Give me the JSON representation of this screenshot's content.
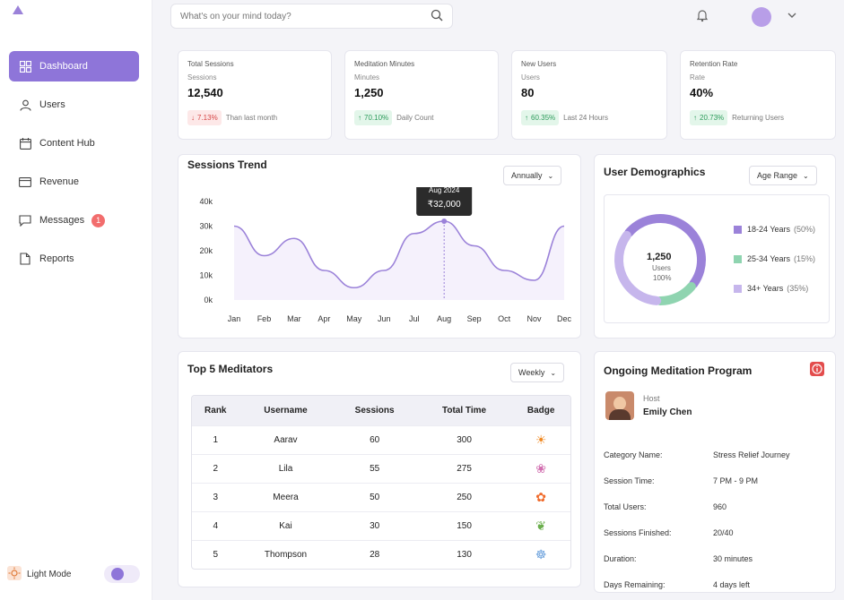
{
  "sidebar": {
    "items": [
      {
        "label": "Dashboard",
        "icon": "grid-icon",
        "active": true
      },
      {
        "label": "Users",
        "icon": "user-icon"
      },
      {
        "label": "Content Hub",
        "icon": "calendar-icon"
      },
      {
        "label": "Revenue",
        "icon": "card-icon"
      },
      {
        "label": "Messages",
        "icon": "message-icon",
        "badge": "1"
      },
      {
        "label": "Reports",
        "icon": "document-icon"
      }
    ],
    "footer": {
      "label": "Light Mode"
    }
  },
  "header": {
    "search_placeholder": "What's on your mind today?"
  },
  "stats": [
    {
      "title": "Total Sessions",
      "sub": "Sessions",
      "value": "12,540",
      "change": "7.13%",
      "dir": "down",
      "caption": "Than last month"
    },
    {
      "title": "Meditation Minutes",
      "sub": "Minutes",
      "value": "1,250",
      "change": "70.10%",
      "dir": "up",
      "caption": "Daily Count"
    },
    {
      "title": "New Users",
      "sub": "Users",
      "value": "80",
      "change": "60.35%",
      "dir": "up",
      "caption": "Last 24 Hours"
    },
    {
      "title": "Retention Rate",
      "sub": "Rate",
      "value": "40%",
      "change": "20.73%",
      "dir": "up",
      "caption": "Returning Users"
    }
  ],
  "chart_card": {
    "title": "Sessions Trend",
    "filter": "Annually",
    "tooltip": {
      "label": "Aug 2024",
      "value": "₹32,000"
    }
  },
  "chart_data": {
    "type": "line",
    "categories": [
      "Jan",
      "Feb",
      "Mar",
      "Apr",
      "May",
      "Jun",
      "Jul",
      "Aug",
      "Sep",
      "Oct",
      "Nov",
      "Dec"
    ],
    "values": [
      30000,
      18000,
      25000,
      12000,
      5000,
      12000,
      27000,
      32000,
      22000,
      12000,
      8000,
      30000
    ],
    "ylim": [
      0,
      40000
    ],
    "yticks": [
      "0k",
      "10k",
      "20k",
      "30k",
      "40k"
    ],
    "highlight_index": 7,
    "colors": {
      "line": "#9b82d9",
      "fill": "#ede6fa"
    }
  },
  "demographics": {
    "title": "User Demographics",
    "filter": "Age Range",
    "center_value": "1,250",
    "center_label": "Users",
    "center_pct": "100%",
    "legend": [
      {
        "label": "18-24 Years",
        "pct": "(50%)",
        "color": "#9b82d9",
        "value": 50
      },
      {
        "label": "25-34 Years",
        "pct": "(15%)",
        "color": "#8fd4b0",
        "value": 15
      },
      {
        "label": "34+ Years",
        "pct": "(35%)",
        "color": "#c6b6ec",
        "value": 35
      }
    ]
  },
  "meditators": {
    "title": "Top 5 Meditators",
    "filter": "Weekly",
    "columns": [
      "Rank",
      "Username",
      "Sessions",
      "Total Time",
      "Badge"
    ],
    "rows": [
      {
        "rank": "1",
        "name": "Aarav",
        "sessions": "60",
        "time": "300",
        "badge": "☀"
      },
      {
        "rank": "2",
        "name": "Lila",
        "sessions": "55",
        "time": "275",
        "badge": "❀"
      },
      {
        "rank": "3",
        "name": "Meera",
        "sessions": "50",
        "time": "250",
        "badge": "✿"
      },
      {
        "rank": "4",
        "name": "Kai",
        "sessions": "30",
        "time": "150",
        "badge": "❦"
      },
      {
        "rank": "5",
        "name": "Thompson",
        "sessions": "28",
        "time": "130",
        "badge": "☸"
      }
    ]
  },
  "program": {
    "title": "Ongoing Meditation Program",
    "host_label": "Host",
    "host_name": "Emily Chen",
    "fields": [
      {
        "label": "Category Name:",
        "value": "Stress Relief Journey"
      },
      {
        "label": "Session Time:",
        "value": "7 PM - 9 PM"
      },
      {
        "label": "Total Users:",
        "value": "960"
      },
      {
        "label": "Sessions Finished:",
        "value": "20/40"
      },
      {
        "label": "Duration:",
        "value": "30 minutes"
      },
      {
        "label": "Days Remaining:",
        "value": "4 days left"
      }
    ]
  }
}
